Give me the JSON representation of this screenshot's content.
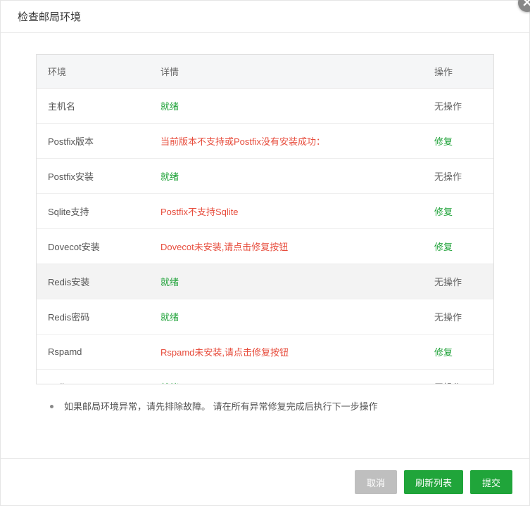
{
  "modal": {
    "title": "检查邮局环境",
    "closeIcon": "close"
  },
  "table": {
    "headers": {
      "env": "环境",
      "detail": "详情",
      "action": "操作"
    },
    "rows": [
      {
        "env": "主机名",
        "detail": "就绪",
        "status": "ok",
        "action": "无操作",
        "actionType": "none"
      },
      {
        "env": "Postfix版本",
        "detail": "当前版本不支持或Postfix没有安装成功：",
        "status": "err",
        "action": "修复",
        "actionType": "fix"
      },
      {
        "env": "Postfix安装",
        "detail": "就绪",
        "status": "ok",
        "action": "无操作",
        "actionType": "none"
      },
      {
        "env": "Sqlite支持",
        "detail": "Postfix不支持Sqlite",
        "status": "err",
        "action": "修复",
        "actionType": "fix"
      },
      {
        "env": "Dovecot安装",
        "detail": "Dovecot未安装,请点击修复按钮",
        "status": "err",
        "action": "修复",
        "actionType": "fix"
      },
      {
        "env": "Redis安装",
        "detail": "就绪",
        "status": "ok",
        "action": "无操作",
        "actionType": "none",
        "highlight": true
      },
      {
        "env": "Redis密码",
        "detail": "就绪",
        "status": "ok",
        "action": "无操作",
        "actionType": "none"
      },
      {
        "env": "Rspamd",
        "detail": "Rspamd未安装,请点击修复按钮",
        "status": "err",
        "action": "修复",
        "actionType": "fix"
      },
      {
        "env": "SElinux",
        "detail": "就绪",
        "status": "ok",
        "action": "无操作",
        "actionType": "none"
      }
    ]
  },
  "note": "如果邮局环境异常，请先排除故障。 请在所有异常修复完成后执行下一步操作",
  "footer": {
    "cancel": "取消",
    "refresh": "刷新列表",
    "submit": "提交"
  }
}
